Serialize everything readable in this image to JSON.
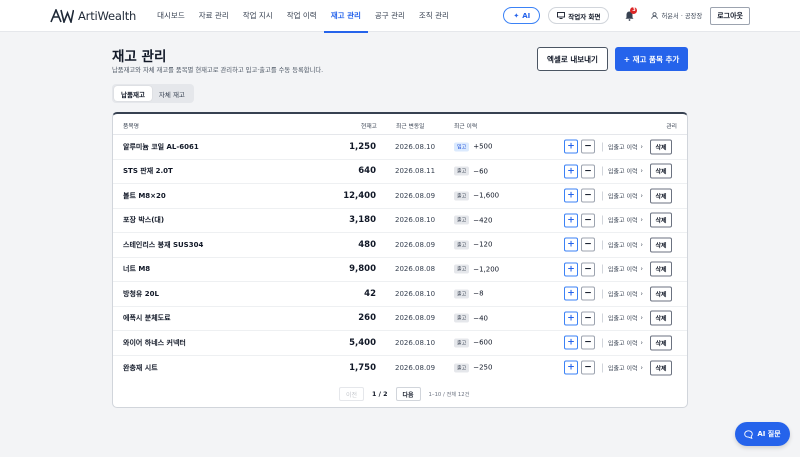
{
  "brand": {
    "name": "ArtiWealth"
  },
  "nav": {
    "items": [
      {
        "label": "대시보드",
        "active": false
      },
      {
        "label": "자료 관리",
        "active": false
      },
      {
        "label": "작업 지시",
        "active": false
      },
      {
        "label": "작업 이력",
        "active": false
      },
      {
        "label": "재고 관리",
        "active": true
      },
      {
        "label": "공구 관리",
        "active": false
      },
      {
        "label": "조직 관리",
        "active": false
      }
    ]
  },
  "header": {
    "ai_label": "AI",
    "worker_label": "작업자 화면",
    "notif_count": "3",
    "user_label": "허윤서 · 공장장",
    "logout_label": "로그아웃"
  },
  "page": {
    "title": "재고 관리",
    "subtitle": "납품재고와 자체 재고를 품목별 현재고로 관리하고 입고·출고를 수동 등록합니다.",
    "export_label": "엑셀로 내보내기",
    "add_label": "+ 재고 품목 추가"
  },
  "tabs": [
    {
      "label": "납품재고",
      "active": true
    },
    {
      "label": "자체 재고",
      "active": false
    }
  ],
  "table": {
    "headers": {
      "name": "품목명",
      "stock": "현재고",
      "date": "최근 변동일",
      "history": "최근 이력",
      "manage": "관리"
    },
    "hist_link_label": "입출고 이력",
    "delete_label": "삭제",
    "rows": [
      {
        "name": "알루미늄 코일 AL-6061",
        "stock": "1,250",
        "date": "2026.08.10",
        "type": "입고",
        "qty": "+500"
      },
      {
        "name": "STS 판재 2.0T",
        "stock": "640",
        "date": "2026.08.11",
        "type": "출고",
        "qty": "−60"
      },
      {
        "name": "볼트 M8×20",
        "stock": "12,400",
        "date": "2026.08.09",
        "type": "출고",
        "qty": "−1,600"
      },
      {
        "name": "포장 박스(대)",
        "stock": "3,180",
        "date": "2026.08.10",
        "type": "출고",
        "qty": "−420"
      },
      {
        "name": "스테인리스 봉재 SUS304",
        "stock": "480",
        "date": "2026.08.09",
        "type": "출고",
        "qty": "−120"
      },
      {
        "name": "너트 M8",
        "stock": "9,800",
        "date": "2026.08.08",
        "type": "출고",
        "qty": "−1,200"
      },
      {
        "name": "방청유 20L",
        "stock": "42",
        "date": "2026.08.10",
        "type": "출고",
        "qty": "−8"
      },
      {
        "name": "에폭시 분체도료",
        "stock": "260",
        "date": "2026.08.09",
        "type": "출고",
        "qty": "−40"
      },
      {
        "name": "와이어 하네스 커넥터",
        "stock": "5,400",
        "date": "2026.08.10",
        "type": "출고",
        "qty": "−600"
      },
      {
        "name": "완충재 시트",
        "stock": "1,750",
        "date": "2026.08.09",
        "type": "출고",
        "qty": "−250"
      }
    ]
  },
  "pagination": {
    "prev_label": "이전",
    "page_info": "1 / 2",
    "next_label": "다음",
    "total": "1–10 / 전체 12건"
  },
  "ai_float_label": "AI 질문",
  "colors": {
    "accent": "#2563eb",
    "danger": "#dc2626"
  }
}
